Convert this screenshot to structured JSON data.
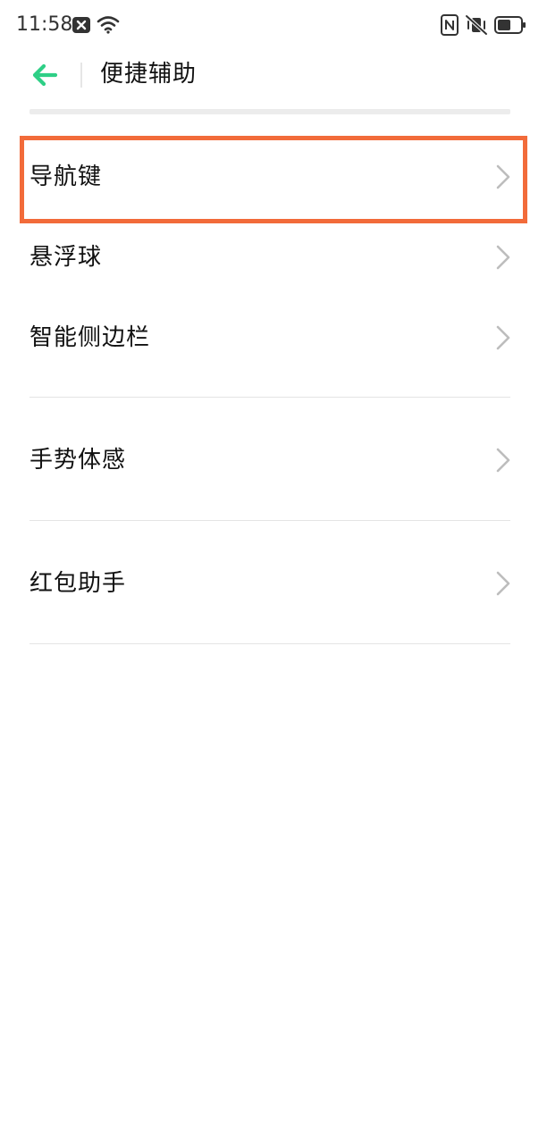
{
  "status_bar": {
    "time": "11:58",
    "icons": [
      "notification-x-icon",
      "wifi-icon",
      "nfc-icon",
      "vibrate-mute-icon",
      "battery-icon"
    ]
  },
  "header": {
    "back_icon": "arrow-left-icon",
    "title": "便捷辅助",
    "accent_color": "#2ecf86"
  },
  "list": {
    "items": [
      {
        "label": "导航键",
        "highlighted": true
      },
      {
        "label": "悬浮球"
      },
      {
        "label": "智能侧边栏"
      },
      {
        "label": "手势体感"
      },
      {
        "label": "红包助手"
      }
    ]
  },
  "colors": {
    "highlight": "#f26b3a",
    "chevron": "#bdbdbd",
    "divider": "#e4e4e4"
  }
}
